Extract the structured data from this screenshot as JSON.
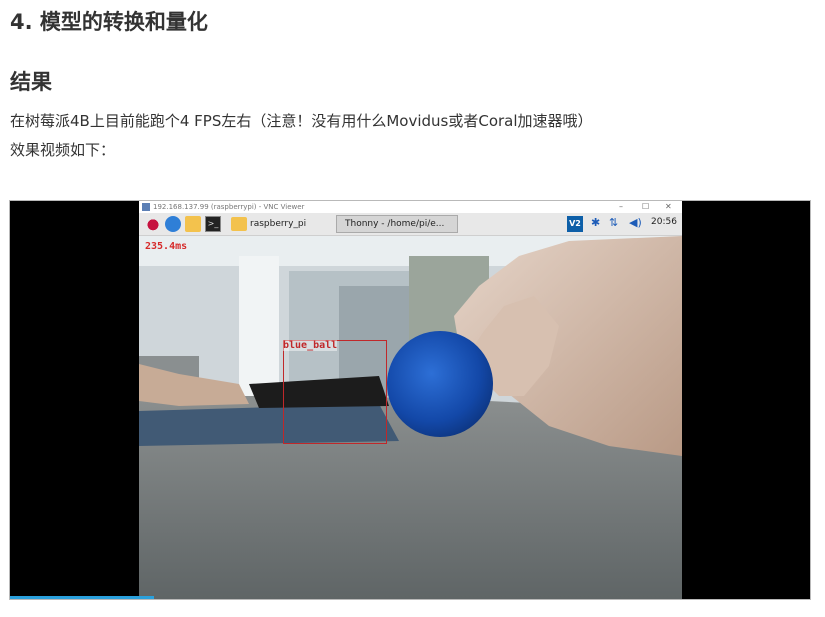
{
  "article": {
    "section_heading": "4. 模型的转换和量化",
    "result_heading": "结果",
    "para1": "在树莓派4B上目前能跑个4 FPS左右（注意！没有用什么Movidus或者Coral加速器哦）",
    "para2": "效果视频如下："
  },
  "video": {
    "progress": 0.18,
    "vnc_window": {
      "title": "192.168.137.99 (raspberrypi) - VNC Viewer",
      "controls": [
        "–",
        "☐",
        "✕"
      ]
    },
    "taskbar": {
      "task_raspberry": "raspberry_pi",
      "task_thonny": "Thonny  -  /home/pi/e...",
      "vnc_label": "V2",
      "clock": "20:56",
      "icons": [
        "raspberry-menu-icon",
        "web-browser-icon",
        "file-manager-icon",
        "terminal-icon",
        "folder-icon",
        "bluetooth-icon",
        "network-icon",
        "volume-icon"
      ]
    },
    "overlay": {
      "inference_time": "235.4ms",
      "detection_label": "blue_ball",
      "box_color": "#c0282a"
    }
  }
}
